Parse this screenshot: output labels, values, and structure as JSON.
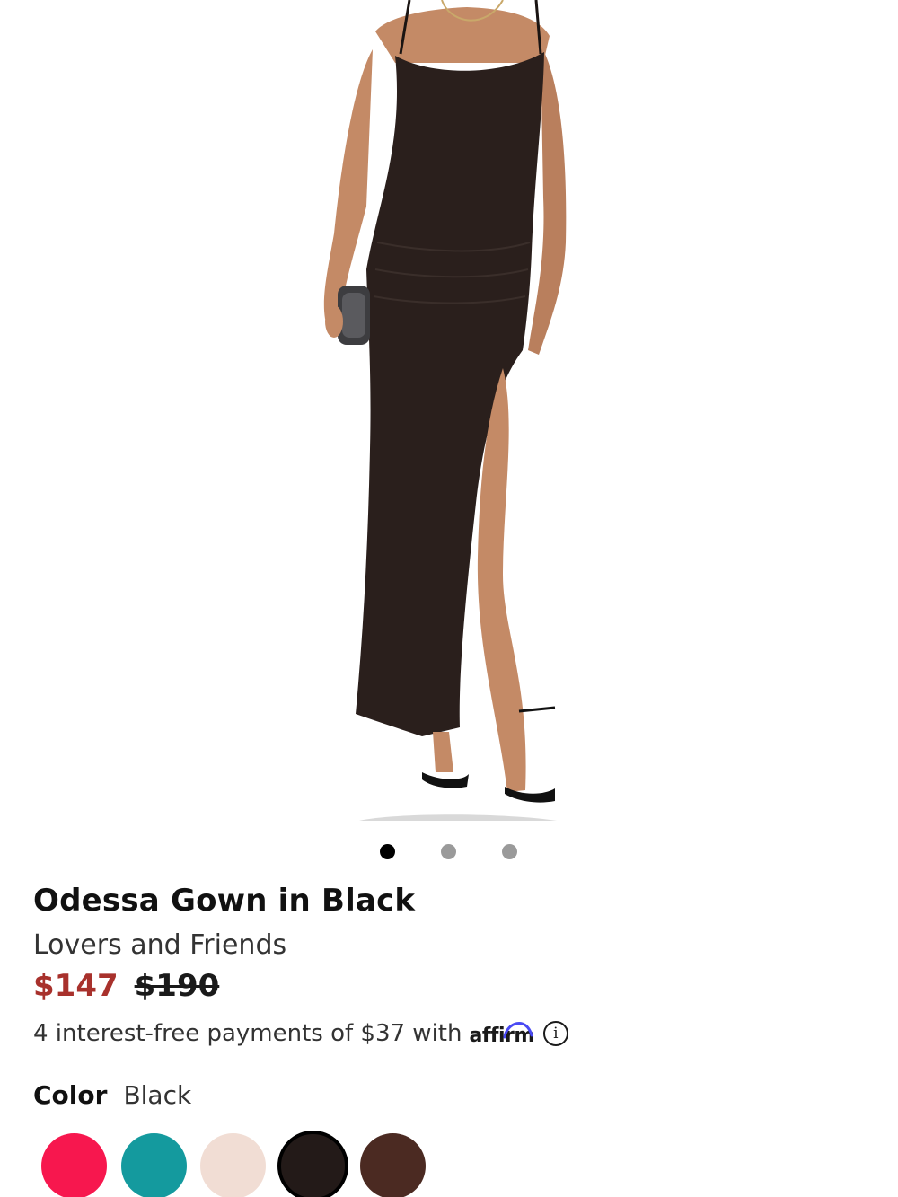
{
  "carousel": {
    "count": 3,
    "active_index": 0
  },
  "product": {
    "title": "Odessa Gown in Black",
    "brand": "Lovers and Friends",
    "sale_price": "$147",
    "original_price": "$190",
    "installments_text": "4 interest-free payments of $37 with",
    "affirm_logo": "affirm",
    "info_glyph": "i"
  },
  "color": {
    "label": "Color",
    "selected": "Black",
    "swatches": [
      {
        "name": "pink",
        "hex": "#f7174e"
      },
      {
        "name": "teal",
        "hex": "#149a9e"
      },
      {
        "name": "blush",
        "hex": "#f1ddd4"
      },
      {
        "name": "black",
        "hex": "#231a18",
        "selected": true
      },
      {
        "name": "brown",
        "hex": "#4b2a22"
      }
    ]
  },
  "colors": {
    "sale_price": "#a8312c",
    "dress": "#2a1f1c",
    "skin": "#c48a66"
  }
}
